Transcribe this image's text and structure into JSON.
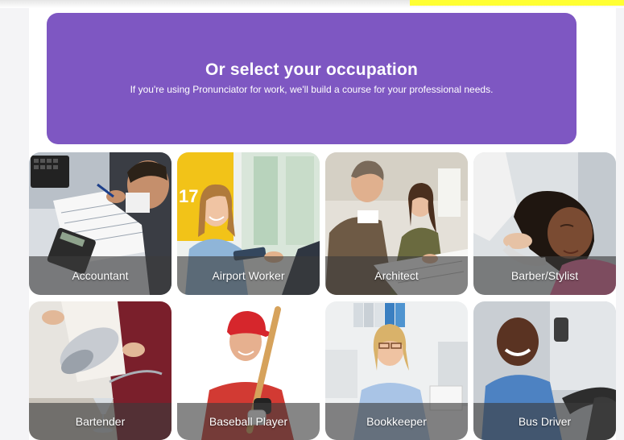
{
  "header": {
    "title": "Or select your occupation",
    "subtitle": "If you're using Pronunciator for work, we'll build a course for your professional needs."
  },
  "occupations": [
    {
      "label": "Accountant"
    },
    {
      "label": "Airport Worker"
    },
    {
      "label": "Architect"
    },
    {
      "label": "Barber/Stylist"
    },
    {
      "label": "Bartender"
    },
    {
      "label": "Baseball Player"
    },
    {
      "label": "Bookkeeper"
    },
    {
      "label": "Bus Driver"
    }
  ],
  "colors": {
    "banner": "#7e57c2",
    "caption_overlay": "rgba(60,60,60,0.62)",
    "top_highlight": "#ffff33"
  }
}
